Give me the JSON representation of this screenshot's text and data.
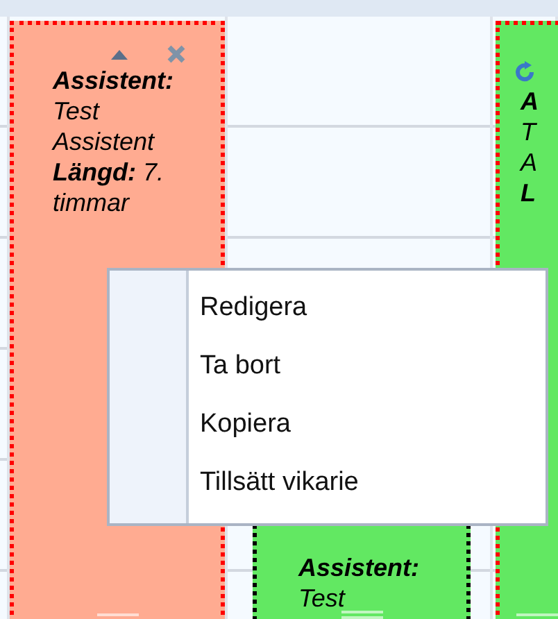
{
  "appointments": [
    {
      "text": "**Assistent:** Test Assistent **Längd:** 7. timmar",
      "color": "#ffab91",
      "selected": false
    },
    {
      "text": "**Assistent:** Test",
      "color": "#62e862",
      "selected": true
    },
    {
      "lines": [
        "**A**",
        "T",
        "A",
        "**L**"
      ],
      "color": "#62e862",
      "selected": false
    }
  ],
  "context_menu": {
    "items": [
      "Redigera",
      "Ta bort",
      "Kopiera",
      "Tillsätt vikarie"
    ]
  }
}
